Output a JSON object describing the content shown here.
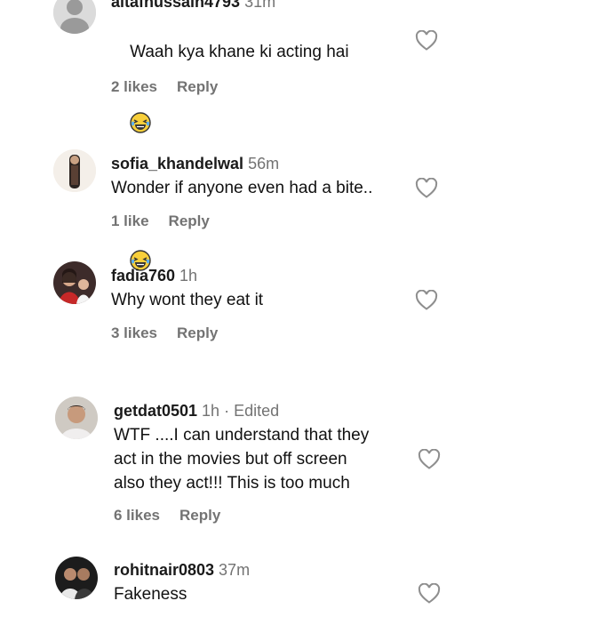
{
  "comments": [
    {
      "username": "altafhussain4793",
      "time": "31m",
      "text": "Waah kya khane ki acting hai",
      "emoji": "laughing-tears-emoji",
      "likes": "2 likes",
      "reply": "Reply",
      "avatar": "default-avatar"
    },
    {
      "username": "sofia_khandelwal",
      "time": "56m",
      "text": "Wonder if anyone even had a bite..",
      "likes": "1 like",
      "reply": "Reply",
      "avatar": "user-photo"
    },
    {
      "username": "fadia760",
      "time": "1h",
      "text": "Why wont they eat it",
      "likes": "3 likes",
      "reply": "Reply",
      "avatar": "user-photo"
    },
    {
      "username": "getdat0501",
      "time": "1h · Edited",
      "text": "WTF ....I can understand that they\nact in the movies but off screen\nalso they act!!! This is too much",
      "likes": "6 likes",
      "reply": "Reply",
      "avatar": "user-photo"
    },
    {
      "username": "rohitnair0803",
      "time": "37m",
      "text": "Fakeness",
      "likes": "",
      "reply": "",
      "avatar": "user-photo"
    }
  ],
  "colors": {
    "text": "#111111",
    "secondary": "#737373",
    "heart_outline": "#8e8e8e"
  },
  "icons": [
    "heart-outline-icon",
    "laughing-tears-emoji",
    "default-avatar-icon"
  ]
}
